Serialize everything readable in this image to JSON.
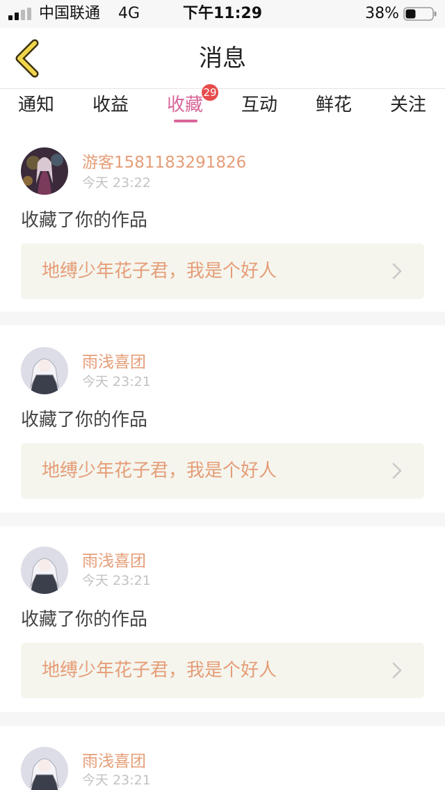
{
  "status_bar": {
    "carrier": "中国联通",
    "network": "4G",
    "time": "下午11:29",
    "battery": "38%",
    "battery_level": 0.38
  },
  "header": {
    "title": "消息",
    "back_icon": "chevron-left-icon"
  },
  "tabs": [
    {
      "label": "通知"
    },
    {
      "label": "收益"
    },
    {
      "label": "收藏",
      "active": true,
      "badge": "29"
    },
    {
      "label": "互动"
    },
    {
      "label": "鲜花"
    },
    {
      "label": "关注"
    }
  ],
  "notifications": [
    {
      "user": "游客1581183291826",
      "time": "今天 23:22",
      "action": "收藏了你的作品",
      "work": "地缚少年花子君，我是个好人"
    },
    {
      "user": "雨浅喜团",
      "time": "今天 23:21",
      "action": "收藏了你的作品",
      "work": "地缚少年花子君，我是个好人"
    },
    {
      "user": "雨浅喜团",
      "time": "今天 23:21",
      "action": "收藏了你的作品",
      "work": "地缚少年花子君，我是个好人"
    },
    {
      "user": "雨浅喜团",
      "time": "今天 23:21",
      "action": "",
      "work": ""
    }
  ],
  "colors": {
    "accent": "#d8659a",
    "username": "#e59d77",
    "badge": "#e74c4c",
    "back_icon": "#f0d64a"
  }
}
